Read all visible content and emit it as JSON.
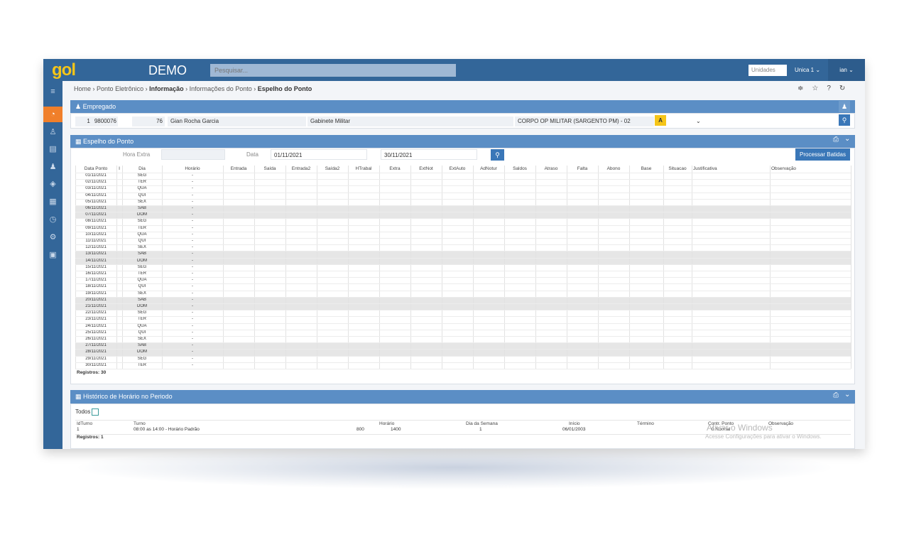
{
  "topbar": {
    "logo_g": "g",
    "logo_o": "o",
    "logo_l": "l",
    "app_name": "DEMO",
    "search_placeholder": "Pesquisar...",
    "unidades": "Unidades",
    "unica": "Unica 1 ⌄",
    "user": "ian ⌄"
  },
  "sidebar_icons": [
    "menu-icon",
    "dashboard-icon",
    "user-icon",
    "document-icon",
    "users-icon",
    "tag-icon",
    "calculator-icon",
    "clock-icon",
    "gear-icon",
    "briefcase-icon"
  ],
  "breadcrumb": {
    "home": "Home",
    "ponto": "Ponto Eletrônico",
    "informacao": "Informação",
    "info_ponto": "Informações do Ponto",
    "current": "Espelho do Ponto",
    "sep": "›"
  },
  "header_icons": {
    "filter": "≑",
    "star": "☆",
    "help": "?",
    "refresh": "↻"
  },
  "empregado": {
    "title": "Empregado",
    "seq": "1",
    "matricula": "9800076",
    "codigo": "76",
    "nome": "Gian Rocha Garcia",
    "lotacao": "Gabinete Militar",
    "cargo": "CORPO OP MILITAR (SARGENTO PM) - 02",
    "badge": "A",
    "select_arrow": "⌄"
  },
  "espelho": {
    "title": "Espelho do Ponto",
    "hora_extra_label": "Hora Extra",
    "data_label": "Data",
    "data_inicio": "01/11/2021",
    "data_fim": "30/11/2021",
    "processar": "Processar Batidas",
    "columns": [
      "Data Ponto",
      "I",
      "Dia",
      "Horário",
      "Entrada",
      "Saída",
      "Entrada2",
      "Saída2",
      "HTrabal",
      "Extra",
      "ExtNot",
      "ExtAuto",
      "AdNotur",
      "Saldos",
      "Atraso",
      "Falta",
      "Abono",
      "Base",
      "Situacao",
      "Justificativa",
      "Observação"
    ],
    "rows": [
      {
        "date": "01/11/2021",
        "dia": "SEG",
        "h": "-",
        "wk": false
      },
      {
        "date": "02/11/2021",
        "dia": "TER",
        "h": "-",
        "wk": false
      },
      {
        "date": "03/11/2021",
        "dia": "QUA",
        "h": "-",
        "wk": false
      },
      {
        "date": "04/11/2021",
        "dia": "QUI",
        "h": "-",
        "wk": false
      },
      {
        "date": "05/11/2021",
        "dia": "SEX",
        "h": "-",
        "wk": false
      },
      {
        "date": "06/11/2021",
        "dia": "SAB",
        "h": "-",
        "wk": true
      },
      {
        "date": "07/11/2021",
        "dia": "DOM",
        "h": "-",
        "wk": true
      },
      {
        "date": "08/11/2021",
        "dia": "SEG",
        "h": "-",
        "wk": false
      },
      {
        "date": "09/11/2021",
        "dia": "TER",
        "h": "-",
        "wk": false
      },
      {
        "date": "10/11/2021",
        "dia": "QUA",
        "h": "-",
        "wk": false
      },
      {
        "date": "11/11/2021",
        "dia": "QUI",
        "h": "-",
        "wk": false
      },
      {
        "date": "12/11/2021",
        "dia": "SEX",
        "h": "-",
        "wk": false
      },
      {
        "date": "13/11/2021",
        "dia": "SAB",
        "h": "-",
        "wk": true
      },
      {
        "date": "14/11/2021",
        "dia": "DOM",
        "h": "-",
        "wk": true
      },
      {
        "date": "15/11/2021",
        "dia": "SEG",
        "h": "-",
        "wk": false
      },
      {
        "date": "16/11/2021",
        "dia": "TER",
        "h": "-",
        "wk": false
      },
      {
        "date": "17/11/2021",
        "dia": "QUA",
        "h": "-",
        "wk": false
      },
      {
        "date": "18/11/2021",
        "dia": "QUI",
        "h": "-",
        "wk": false
      },
      {
        "date": "19/11/2021",
        "dia": "SEX",
        "h": "-",
        "wk": false
      },
      {
        "date": "20/11/2021",
        "dia": "SAB",
        "h": "-",
        "wk": true
      },
      {
        "date": "21/11/2021",
        "dia": "DOM",
        "h": "-",
        "wk": true
      },
      {
        "date": "22/11/2021",
        "dia": "SEG",
        "h": "-",
        "wk": false
      },
      {
        "date": "23/11/2021",
        "dia": "TER",
        "h": "-",
        "wk": false
      },
      {
        "date": "24/11/2021",
        "dia": "QUA",
        "h": "-",
        "wk": false
      },
      {
        "date": "25/11/2021",
        "dia": "QUI",
        "h": "-",
        "wk": false
      },
      {
        "date": "26/11/2021",
        "dia": "SEX",
        "h": "-",
        "wk": false
      },
      {
        "date": "27/11/2021",
        "dia": "SAB",
        "h": "-",
        "wk": true
      },
      {
        "date": "28/11/2021",
        "dia": "DOM",
        "h": "-",
        "wk": true
      },
      {
        "date": "29/11/2021",
        "dia": "SEG",
        "h": "-",
        "wk": false
      },
      {
        "date": "30/11/2021",
        "dia": "TER",
        "h": "-",
        "wk": false
      }
    ],
    "registros": "Registros: 30"
  },
  "historico": {
    "title": "Histórico de Horário no Periodo",
    "todos": "Todos",
    "columns": {
      "idturno": "IdTurno",
      "turno": "Turno",
      "horario": "Horário",
      "dia_semana": "Dia da Semana",
      "inicio": "Início",
      "termino": "Término",
      "contr_ponto": "Contr. Ponto",
      "observacao": "Observação"
    },
    "row": {
      "idturno": "1",
      "turno": "08:00 as 14:00 - Horário Padrão",
      "h1": "800",
      "h2": "1400",
      "dia": "1",
      "inicio": "06/01/2003",
      "contr": "0 Normal"
    },
    "registros": "Registros: 1"
  },
  "watermark": {
    "line1": "Ativar o Windows",
    "line2": "Acesse Configurações para ativar o Windows."
  },
  "colors": {
    "topbar": "#336699",
    "panel_header": "#5b8ec5",
    "accent_orange": "#f07f2a",
    "badge_yellow": "#f5c518",
    "button_blue": "#3a77b8"
  }
}
